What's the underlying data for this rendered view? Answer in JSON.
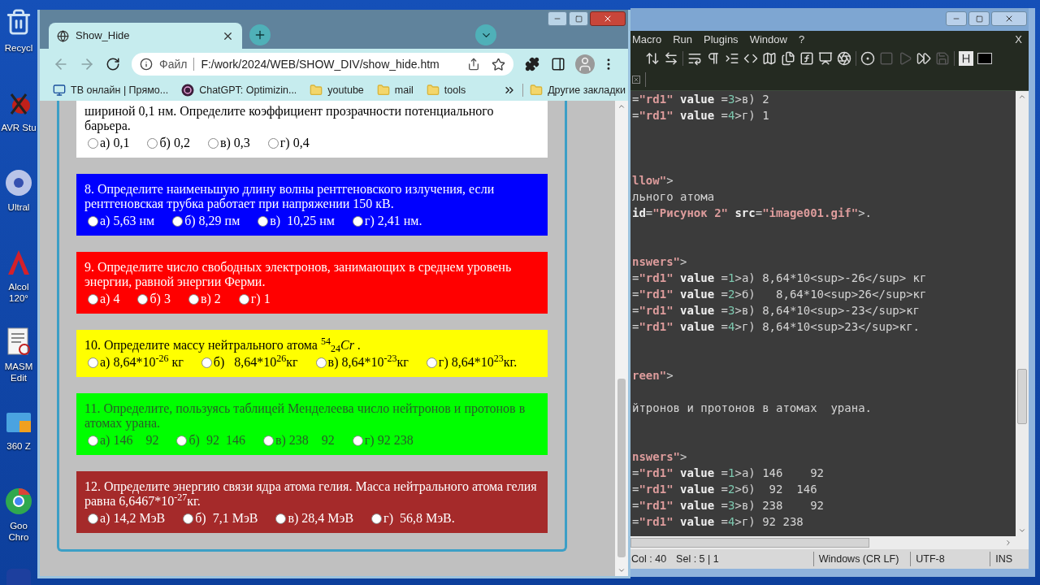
{
  "desktop_icons": [
    {
      "kind": "recycle",
      "label": "Recycl"
    },
    {
      "kind": "bug",
      "label": "AVR Stu"
    },
    {
      "kind": "disc",
      "label": "Ultral"
    },
    {
      "kind": "red",
      "label": "Alcol\n120°"
    },
    {
      "kind": "document",
      "label": "MASM\nEdit"
    },
    {
      "kind": "folder",
      "label": "360 Z"
    },
    {
      "kind": "chrome",
      "label": "Goo\nChro"
    },
    {
      "kind": "blue"
    }
  ],
  "browser": {
    "tab": {
      "title": "Show_Hide"
    },
    "address": {
      "scheme": "Файл",
      "url": "F:/work/2024/WEB/SHOW_DIV/show_hide.htm"
    },
    "bookmarks": [
      {
        "kind": "tv",
        "label": "ТВ онлайн | Прямо..."
      },
      {
        "kind": "chatgpt",
        "label": "ChatGPT: Optimizin..."
      },
      {
        "kind": "folder",
        "label": "youtube"
      },
      {
        "kind": "folder",
        "label": "mail"
      },
      {
        "kind": "folder",
        "label": "tools"
      }
    ],
    "other_bookmarks": "Другие закладки",
    "questions": [
      {
        "color": "#ffffff",
        "kind": "dark",
        "text": "шириной 0,1 нм. Определите коэффициент прозрачности потенциального барьера.",
        "options": [
          {
            "label": "а) 0,1",
            "selected": false
          },
          {
            "label": "б) 0,2",
            "selected": false
          },
          {
            "label": "в) 0,3",
            "selected": false
          },
          {
            "label": "г) 0,4",
            "selected": false
          }
        ]
      },
      {
        "color": "#0000ff",
        "kind": "light",
        "text": "8. Определите наименьшую длину волны рентгеновского излучения, если рентгеновская трубка работает при напряжении 150 кВ.",
        "options": [
          {
            "label": "а) 5,63 нм",
            "selected": false
          },
          {
            "label": "б) 8,29 пм",
            "selected": false
          },
          {
            "label": "в)  10,25 нм",
            "selected": false
          },
          {
            "label": "г) 2,41 нм.",
            "selected": false
          }
        ]
      },
      {
        "color": "#ff0000",
        "kind": "light",
        "text": "9.  Определите число свободных электронов, занимающих в среднем уровень энергии, равной энергии Ферми.",
        "options": [
          {
            "label": "а) 4",
            "selected": false
          },
          {
            "label": "б) 3",
            "selected": false
          },
          {
            "label": "в) 2",
            "selected": false
          },
          {
            "label": "г) 1",
            "selected": false
          }
        ]
      },
      {
        "color": "#ffff00",
        "kind": "dark",
        "text": "10.  Определите массу нейтрального атома $^{54}$$_{24}$*Cr* .",
        "options": [
          {
            "label": "а) 8,64*10$^{-26}$ кг",
            "selected": false
          },
          {
            "label": "б)   8,64*10$^{26}$кг",
            "selected": false
          },
          {
            "label": "в) 8,64*10$^{-23}$кг",
            "selected": false
          },
          {
            "label": "г) 8,64*10$^{23}$кг.",
            "selected": false
          }
        ]
      },
      {
        "color": "#00ff00",
        "kind": "muted",
        "text": "11. Определите, пользуясь таблицей Менделеева число нейтронов и протонов в атомах  урана.",
        "options": [
          {
            "label": "а) 146    92",
            "selected": false
          },
          {
            "label": "б)  92  146",
            "selected": false
          },
          {
            "label": "в) 238    92",
            "selected": false
          },
          {
            "label": "г) 92 238",
            "selected": false
          }
        ]
      },
      {
        "color": "#a52a2a",
        "kind": "light",
        "text": "12. Определите энергию связи ядра атома гелия. Масса нейтрального атома гелия равна 6,6467*10$^{-27}$кг.",
        "options": [
          {
            "label": "а) 14,2 МэВ",
            "selected": false
          },
          {
            "label": "б)  7,1 МэВ",
            "selected": false
          },
          {
            "label": "в) 28,4 МэВ",
            "selected": false
          },
          {
            "label": "г)  56,8 МэВ.",
            "selected": false
          }
        ]
      }
    ]
  },
  "editor": {
    "menu": [
      "Macro",
      "Run",
      "Plugins",
      "Window",
      "?"
    ],
    "menu_close": "X",
    "lines": [
      {
        "kind": "code",
        "segments": [
          {
            "kind": "plain",
            "text": "="
          },
          {
            "kind": "str",
            "text": "\"rd1\""
          },
          {
            "kind": "key",
            "text": " value"
          },
          {
            "kind": "plain",
            "text": " ="
          },
          {
            "kind": "num",
            "text": "3"
          },
          {
            "kind": "plain",
            "text": ">в) 2"
          }
        ]
      },
      {
        "kind": "code",
        "segments": [
          {
            "kind": "plain",
            "text": "="
          },
          {
            "kind": "str",
            "text": "\"rd1\""
          },
          {
            "kind": "key",
            "text": " value"
          },
          {
            "kind": "plain",
            "text": " ="
          },
          {
            "kind": "num",
            "text": "4"
          },
          {
            "kind": "plain",
            "text": ">г) 1"
          }
        ]
      },
      {
        "kind": "blank"
      },
      {
        "kind": "blank"
      },
      {
        "kind": "blank"
      },
      {
        "kind": "code",
        "segments": [
          {
            "kind": "str",
            "text": "llow\""
          },
          {
            "kind": "plain",
            "text": ">"
          }
        ]
      },
      {
        "kind": "code",
        "segments": [
          {
            "kind": "plain",
            "text": "льного атома"
          }
        ]
      },
      {
        "kind": "code",
        "segments": [
          {
            "kind": "key",
            "text": "id"
          },
          {
            "kind": "plain",
            "text": "="
          },
          {
            "kind": "str",
            "text": "\"Рисунок 2\""
          },
          {
            "kind": "key",
            "text": " src"
          },
          {
            "kind": "plain",
            "text": "="
          },
          {
            "kind": "str",
            "text": "\"image001.gif\""
          },
          {
            "kind": "plain",
            "text": ">."
          }
        ]
      },
      {
        "kind": "blank"
      },
      {
        "kind": "blank"
      },
      {
        "kind": "code",
        "segments": [
          {
            "kind": "str",
            "text": "nswers\""
          },
          {
            "kind": "plain",
            "text": ">"
          }
        ]
      },
      {
        "kind": "code",
        "segments": [
          {
            "kind": "plain",
            "text": "="
          },
          {
            "kind": "str",
            "text": "\"rd1\""
          },
          {
            "kind": "key",
            "text": " value"
          },
          {
            "kind": "plain",
            "text": " ="
          },
          {
            "kind": "num",
            "text": "1"
          },
          {
            "kind": "plain",
            "text": ">а) 8,64*10<sup>-26</sup> кг"
          }
        ]
      },
      {
        "kind": "code",
        "segments": [
          {
            "kind": "plain",
            "text": "="
          },
          {
            "kind": "str",
            "text": "\"rd1\""
          },
          {
            "kind": "key",
            "text": " value"
          },
          {
            "kind": "plain",
            "text": " ="
          },
          {
            "kind": "num",
            "text": "2"
          },
          {
            "kind": "plain",
            "text": ">б)   8,64*10<sup>26</sup>кг"
          }
        ]
      },
      {
        "kind": "code",
        "segments": [
          {
            "kind": "plain",
            "text": "="
          },
          {
            "kind": "str",
            "text": "\"rd1\""
          },
          {
            "kind": "key",
            "text": " value"
          },
          {
            "kind": "plain",
            "text": " ="
          },
          {
            "kind": "num",
            "text": "3"
          },
          {
            "kind": "plain",
            "text": ">в) 8,64*10<sup>-23</sup>кг"
          }
        ]
      },
      {
        "kind": "code",
        "segments": [
          {
            "kind": "plain",
            "text": "="
          },
          {
            "kind": "str",
            "text": "\"rd1\""
          },
          {
            "kind": "key",
            "text": " value"
          },
          {
            "kind": "plain",
            "text": " ="
          },
          {
            "kind": "num",
            "text": "4"
          },
          {
            "kind": "plain",
            "text": ">г) 8,64*10<sup>23</sup>кг."
          }
        ]
      },
      {
        "kind": "blank"
      },
      {
        "kind": "blank"
      },
      {
        "kind": "code",
        "segments": [
          {
            "kind": "str",
            "text": "reen\""
          },
          {
            "kind": "plain",
            "text": ">"
          }
        ]
      },
      {
        "kind": "blank"
      },
      {
        "kind": "code",
        "segments": [
          {
            "kind": "plain",
            "text": "йтронов и протонов в атомах  урана."
          }
        ]
      },
      {
        "kind": "blank"
      },
      {
        "kind": "blank"
      },
      {
        "kind": "code",
        "segments": [
          {
            "kind": "str",
            "text": "nswers\""
          },
          {
            "kind": "plain",
            "text": ">"
          }
        ]
      },
      {
        "kind": "code",
        "segments": [
          {
            "kind": "plain",
            "text": "="
          },
          {
            "kind": "str",
            "text": "\"rd1\""
          },
          {
            "kind": "key",
            "text": " value"
          },
          {
            "kind": "plain",
            "text": " ="
          },
          {
            "kind": "num",
            "text": "1"
          },
          {
            "kind": "plain",
            "text": ">а) 146    92"
          }
        ]
      },
      {
        "kind": "code",
        "segments": [
          {
            "kind": "plain",
            "text": "="
          },
          {
            "kind": "str",
            "text": "\"rd1\""
          },
          {
            "kind": "key",
            "text": " value"
          },
          {
            "kind": "plain",
            "text": " ="
          },
          {
            "kind": "num",
            "text": "2"
          },
          {
            "kind": "plain",
            "text": ">б)  92  146"
          }
        ]
      },
      {
        "kind": "code",
        "segments": [
          {
            "kind": "plain",
            "text": "="
          },
          {
            "kind": "str",
            "text": "\"rd1\""
          },
          {
            "kind": "key",
            "text": " value"
          },
          {
            "kind": "plain",
            "text": " ="
          },
          {
            "kind": "num",
            "text": "3"
          },
          {
            "kind": "plain",
            "text": ">в) 238    92"
          }
        ]
      },
      {
        "kind": "code",
        "segments": [
          {
            "kind": "plain",
            "text": "="
          },
          {
            "kind": "str",
            "text": "\"rd1\""
          },
          {
            "kind": "key",
            "text": " value"
          },
          {
            "kind": "plain",
            "text": " ="
          },
          {
            "kind": "num",
            "text": "4"
          },
          {
            "kind": "plain",
            "text": ">г) 92 238"
          }
        ]
      }
    ],
    "status": {
      "position": "Col : 40",
      "selection": "Sel : 5 | 1",
      "eol": "Windows (CR LF)",
      "encoding": "UTF-8",
      "mode": "INS"
    }
  }
}
